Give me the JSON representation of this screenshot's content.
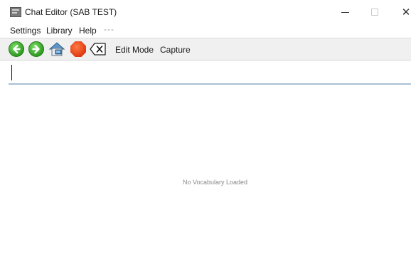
{
  "window": {
    "title": "Chat Editor (SAB TEST)",
    "controls": {
      "minimize": "minimize",
      "maximize": "maximize",
      "close": "✕"
    }
  },
  "menu": {
    "items": [
      "Settings",
      "Library",
      "Help"
    ],
    "overflow": "---"
  },
  "toolbar": {
    "buttons": [
      {
        "icon": "back-arrow-icon"
      },
      {
        "icon": "forward-arrow-icon"
      },
      {
        "icon": "home-icon"
      },
      {
        "icon": "stop-icon"
      },
      {
        "icon": "clear-input-icon"
      }
    ],
    "edit_mode_label": "Edit Mode",
    "capture_label": "Capture",
    "colors": {
      "go": "#2f9a21",
      "stop": "#e03a10",
      "house": "#6aa8d8"
    }
  },
  "message_bar": {
    "value": ""
  },
  "vocabulary": {
    "status": "No Vocabulary Loaded"
  }
}
